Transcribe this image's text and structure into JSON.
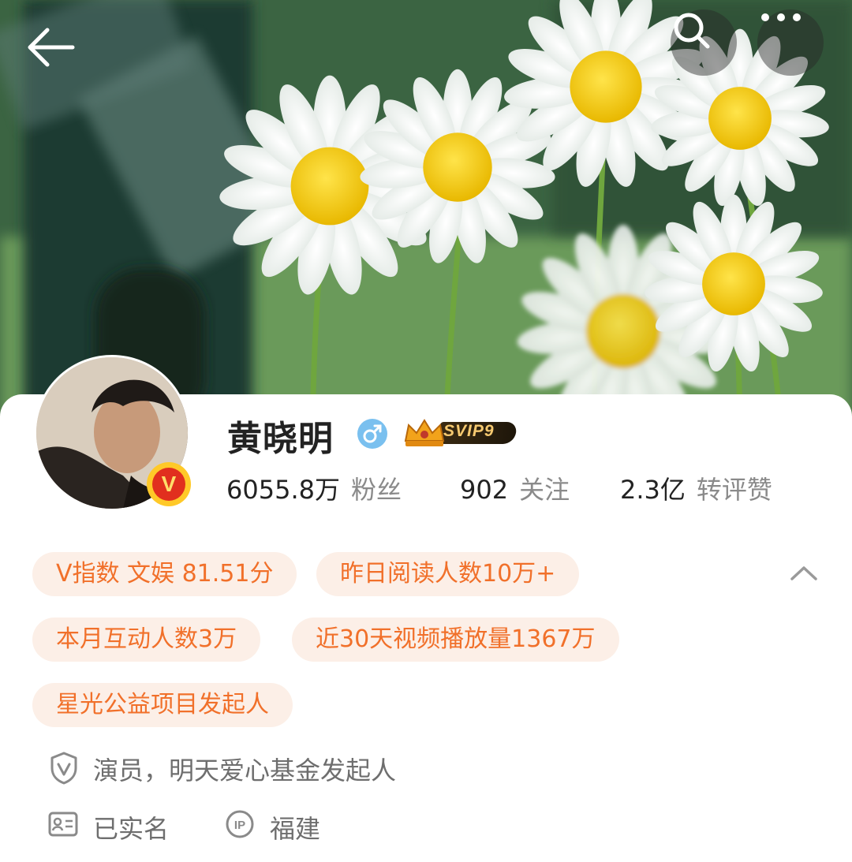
{
  "header": {
    "back_icon": "arrow-left-icon",
    "search_icon": "search-icon",
    "more_icon": "more-horizontal-icon"
  },
  "profile": {
    "name": "黄晓明",
    "gender_icon": "male-icon",
    "verified_badge": "V",
    "vip_label": "SVIP9",
    "stats": [
      {
        "value": "6055.8万",
        "label": "粉丝"
      },
      {
        "value": "902",
        "label": "关注"
      },
      {
        "value": "2.3亿",
        "label": "转评赞"
      }
    ]
  },
  "tags": [
    "V指数 文娱 81.51分",
    "昨日阅读人数10万+",
    "本月互动人数3万",
    "近30天视频播放量1367万",
    "星光公益项目发起人"
  ],
  "info": {
    "verification": "演员，明天爱心基金发起人",
    "real_name": "已实名",
    "ip_location": "福建"
  },
  "colors": {
    "tag_bg": "#fcefe7",
    "tag_text": "#f1702a",
    "verified_red": "#e12f1e",
    "gender_blue": "#7ac0ef"
  }
}
